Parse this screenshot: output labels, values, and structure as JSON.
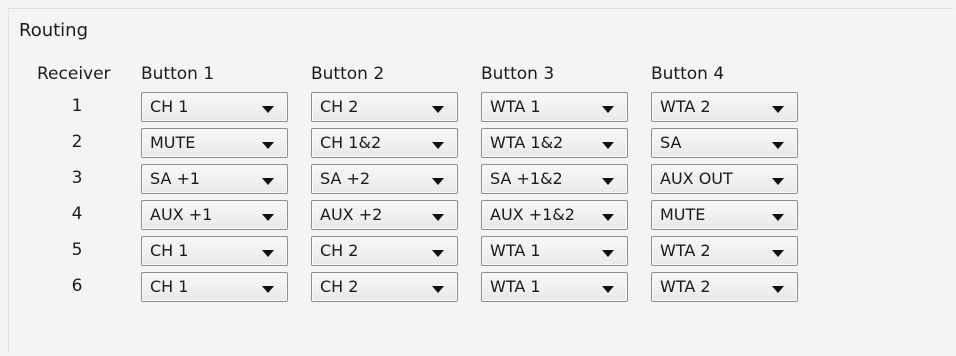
{
  "group": {
    "title": "Routing"
  },
  "headers": {
    "receiver": "Receiver",
    "b1": "Button 1",
    "b2": "Button 2",
    "b3": "Button 3",
    "b4": "Button 4"
  },
  "rows": [
    {
      "receiver": "1",
      "b1": "CH 1",
      "b2": "CH 2",
      "b3": "WTA 1",
      "b4": "WTA 2"
    },
    {
      "receiver": "2",
      "b1": "MUTE",
      "b2": "CH 1&2",
      "b3": "WTA 1&2",
      "b4": "SA"
    },
    {
      "receiver": "3",
      "b1": "SA +1",
      "b2": "SA +2",
      "b3": "SA +1&2",
      "b4": "AUX OUT"
    },
    {
      "receiver": "4",
      "b1": "AUX +1",
      "b2": "AUX +2",
      "b3": "AUX +1&2",
      "b4": "MUTE"
    },
    {
      "receiver": "5",
      "b1": "CH 1",
      "b2": "CH 2",
      "b3": "WTA 1",
      "b4": "WTA 2"
    },
    {
      "receiver": "6",
      "b1": "CH 1",
      "b2": "CH 2",
      "b3": "WTA 1",
      "b4": "WTA 2"
    }
  ]
}
